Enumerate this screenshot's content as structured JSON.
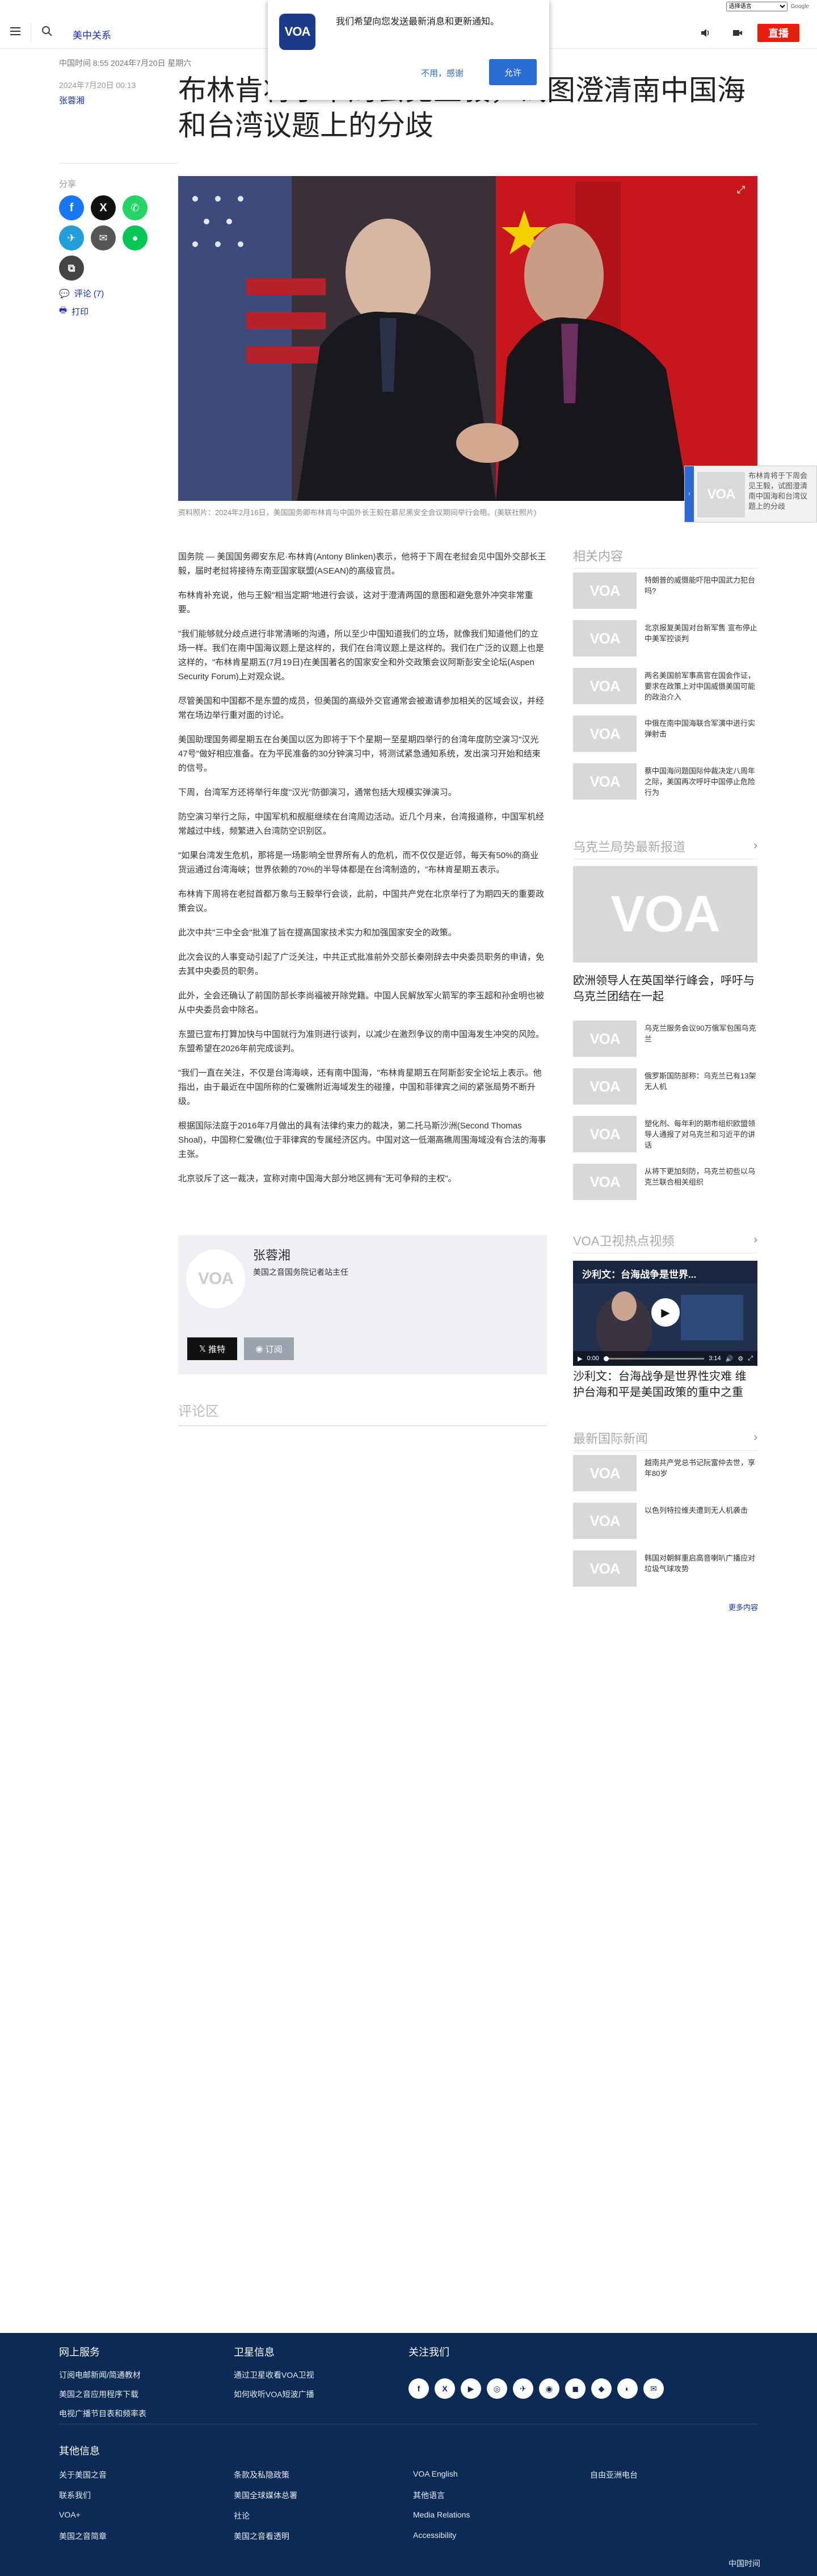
{
  "translate": {
    "select_label": "选择语言",
    "powered": "Google"
  },
  "header": {
    "section": "美中关系",
    "live": "直播"
  },
  "notification": {
    "message": "我们希望向您发送最新消息和更新通知。",
    "decline": "不用，感谢",
    "allow": "允许"
  },
  "article": {
    "date_line": "中国时间 8:55 2024年7月20日 星期六",
    "date_updated": "2024年7月20日 00:13",
    "author": "张蓉湘",
    "title": "布林肯将于下周会见王毅，试图澄清南中国海和台湾议题上的分歧",
    "share_label": "分享",
    "comments_link": "评论 (7)",
    "print_link": "打印",
    "caption": "资料照片：2024年2月16日，美国国务卿布林肯与中国外长王毅在慕尼黑安全会议期间举行会晤。(美联社照片)",
    "paragraphs": [
      "国务院 — 美国国务卿安东尼·布林肯(Antony Blinken)表示，他将于下周在老挝会见中国外交部长王毅，届时老挝将接待东南亚国家联盟(ASEAN)的高级官员。",
      "布林肯补充说，他与王毅\"相当定期\"地进行会谈，这对于澄清两国的意图和避免意外冲突非常重要。",
      "\"我们能够就分歧点进行非常清晰的沟通，所以至少中国知道我们的立场，就像我们知道他们的立场一样。我们在南中国海议题上是这样的，我们在台湾议题上是这样的。我们在广泛的议题上也是这样的，\"布林肯星期五(7月19日)在美国著名的国家安全和外交政策会议阿斯彭安全论坛(Aspen Security Forum)上对观众说。",
      "尽管美国和中国都不是东盟的成员，但美国的高级外交官通常会被邀请参加相关的区域会议，并经常在场边举行重对面的讨论。",
      "美国助理国务卿星期五在台美国以区为即将于下个星期一至星期四举行的台湾年度防空演习\"汉光47号\"做好相应准备。在为平民准备的30分钟演习中，将测试紧急通知系统，发出演习开始和结束的信号。",
      "下周，台湾军方还将举行年度\"汉光\"防御演习，通常包括大规模实弹演习。",
      "防空演习举行之际，中国军机和舰艇继续在台湾周边活动。近几个月来，台湾报道称，中国军机经常越过中线，频繁进入台湾防空识别区。",
      "\"如果台湾发生危机，那将是一场影响全世界所有人的危机，而不仅仅是近邻，每天有50%的商业货运通过台湾海峡；世界依赖的70%的半导体都是在台湾制造的，\"布林肯星期五表示。",
      "布林肯下周将在老挝首都万象与王毅举行会谈，此前，中国共产党在北京举行了为期四天的重要政策会议。",
      "此次中共\"三中全会\"批准了旨在提高国家技术实力和加强国家安全的政策。",
      "此次会议的人事变动引起了广泛关注，中共正式批准前外交部长秦刚辞去中央委员职务的申请，免去其中央委员的职务。",
      "此外，全会还确认了前国防部长李尚福被开除党籍。中国人民解放军火箭军的李玉超和孙金明也被从中央委员会中除名。",
      "东盟已宣布打算加快与中国就行为准则进行谈判，以减少在激烈争议的南中国海发生冲突的风险。东盟希望在2026年前完成谈判。",
      "\"我们一直在关注，不仅是台湾海峡，还有南中国海，\"布林肯星期五在阿斯彭安全论坛上表示。他指出，由于最近在中国所称的仁爱礁附近海域发生的碰撞，中国和菲律宾之间的紧张局势不断升级。",
      "根据国际法庭于2016年7月做出的具有法律约束力的裁决，第二托马斯沙洲(Second Thomas Shoal)，中国称仁爱礁(位于菲律宾的专属经济区内。中国对这一低潮高礁周围海域没有合法的海事主张。",
      "北京驳斥了这一裁决，宣称对南中国海大部分地区拥有\"无可争辩的主权\"。"
    ]
  },
  "author_box": {
    "name": "张蓉湘",
    "role": "美国之音国务院记者站主任",
    "follow_x": "推特",
    "subscribe": "订阅"
  },
  "comments_title": "评论区",
  "sidebar": {
    "related_title": "相关内容",
    "related": [
      "特朗普的威慑能吓阻中国武力犯台吗?",
      "北京报复美国对台新军售 宣布停止中美军控谈判",
      "两名美国前军事高官在国会作证，要求在政策上对中国威慑美国可能的政治介入",
      "中俄在南中国海联合军演中进行实弹射击",
      "蔡中国海问题国际仲裁决定八周年之际，美国再次呼吁中国停止危险行为"
    ],
    "ukraine_title": "乌克兰局势最新报道",
    "ukraine_feature": "欧洲领导人在英国举行峰会，呼吁与乌克兰团结在一起",
    "ukraine": [
      "乌克兰服务会议90万俄军包围乌克兰",
      "俄罗斯国防部称：乌克兰已有13架无人机",
      "塑化剂、每年利的期市组织欧盟领导人通报了对乌克兰和习近平的讲话",
      "从将下更加刻防，乌克兰初些以乌克兰联合相关组织"
    ],
    "video_title": "VOA卫视热点视频",
    "video_overlay": "沙利文：台海战争是世界...",
    "video_time_cur": "0:00",
    "video_time_tot": "3:14",
    "video_caption": "沙利文：台海战争是世界性灾难 维护台海和平是美国政策的重中之重",
    "intl_title": "最新国际新闻",
    "intl": [
      "越南共产党总书记阮富仲去世，享年80岁",
      "以色列特拉维夫遭到无人机袭击",
      "韩国对朝鲜重启高音喇叭广播应对垃圾气球攻势"
    ],
    "more": "更多内容"
  },
  "footer": {
    "col1_title": "网上服务",
    "col1": [
      "订阅电邮新闻/简通教材",
      "美国之音应用程序下载",
      "电视广播节目表和频率表"
    ],
    "col2_title": "卫星信息",
    "col2": [
      "通过卫星收看VOA卫视",
      "如何收听VOA短波广播"
    ],
    "col3_title": "关注我们",
    "social": [
      "f",
      "X",
      "▶",
      "◎",
      "✈",
      "◉",
      "◼",
      "◆",
      "◐",
      "✉"
    ],
    "other_title": "其他信息",
    "links": [
      "关于美国之音",
      "联系我们",
      "VOA+",
      "美国之音简章",
      "条款及私隐政策",
      "美国全球媒体总署",
      "社论",
      "美国之音看透明",
      "VOA English",
      "其他语言",
      "Media Relations",
      "Accessibility",
      "自由亚洲电台"
    ],
    "copyright": "中国时间"
  },
  "icons": {
    "voa_logo": "VOA",
    "colors": {
      "brand": "#1330bf",
      "live": "#e91d0c",
      "footer": "#0b2a55"
    }
  }
}
